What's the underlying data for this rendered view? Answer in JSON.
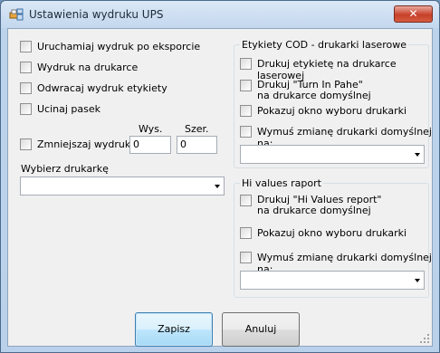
{
  "window": {
    "title": "Ustawienia wydruku UPS",
    "close_glyph": "✕",
    "icon": "printer-settings-icon"
  },
  "options": {
    "export_print": "Uruchamiaj wydruk po eksporcie",
    "printer_print": "Wydruk na drukarce",
    "reverse_labels": "Odwracaj wydruk etykiety",
    "cut_strip": "Ucinaj pasek",
    "shrink_print": "Zmniejszaj wydruk",
    "height_label": "Wys.",
    "width_label": "Szer.",
    "height_value": "0",
    "width_value": "0",
    "choose_printer_label": "Wybierz drukarkę",
    "printer_selected": ""
  },
  "cod_group": {
    "legend": "Etykiety COD - drukarki laserowe",
    "print_laser": "Drukuj etykietę na drukarce laserowej",
    "turn_in_line1": "Drukuj \"Turn In Pahe\"",
    "turn_in_line2": "na drukarce domyślnej",
    "show_dialog": "Pokazuj okno wyboru drukarki",
    "force_change": "Wymuś zmianę drukarki domyślnej na:",
    "printer_selected": ""
  },
  "hv_group": {
    "legend": "Hi values raport",
    "print_line1": "Drukuj \"Hi Values report\"",
    "print_line2": "na drukarce domyślnej",
    "show_dialog": "Pokazuj okno wyboru drukarki",
    "force_change": "Wymuś zmianę drukarki domyślnej na:",
    "printer_selected": ""
  },
  "buttons": {
    "save": "Zapisz",
    "cancel": "Anuluj"
  }
}
